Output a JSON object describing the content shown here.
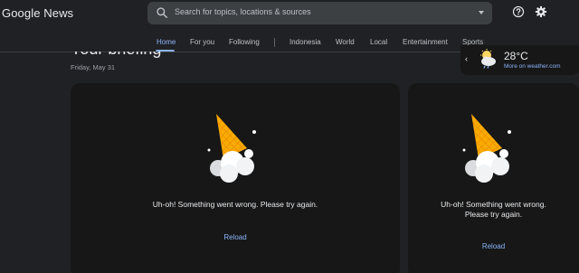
{
  "header": {
    "logo_google": "Google",
    "logo_news": "News",
    "search_placeholder": "Search for topics, locations & sources",
    "icons": [
      "search-icon",
      "dropdown-icon",
      "help-icon",
      "settings-icon"
    ]
  },
  "tabs": {
    "items": [
      {
        "label": "Home",
        "active": true
      },
      {
        "label": "For you",
        "active": false
      },
      {
        "label": "Following",
        "active": false
      },
      {
        "label": "Indonesia",
        "active": false
      },
      {
        "label": "World",
        "active": false
      },
      {
        "label": "Local",
        "active": false
      },
      {
        "label": "Entertainment",
        "active": false
      },
      {
        "label": "Sports",
        "active": false
      }
    ]
  },
  "briefing": {
    "title": "Your briefing",
    "date": "Friday, May 31"
  },
  "weather": {
    "temperature": "28°C",
    "link": "More on weather.com",
    "icon": "partly-cloudy-icon"
  },
  "cards": [
    {
      "error": "Uh-oh! Something went wrong. Please try again.",
      "action": "Reload"
    },
    {
      "error_line1": "Uh-oh! Something went wrong.",
      "error_line2": "Please try again.",
      "action": "Reload"
    }
  ],
  "colors": {
    "background": "#202124",
    "card": "#171717",
    "accent": "#8ab4f8",
    "cone": "#f9ab00"
  }
}
